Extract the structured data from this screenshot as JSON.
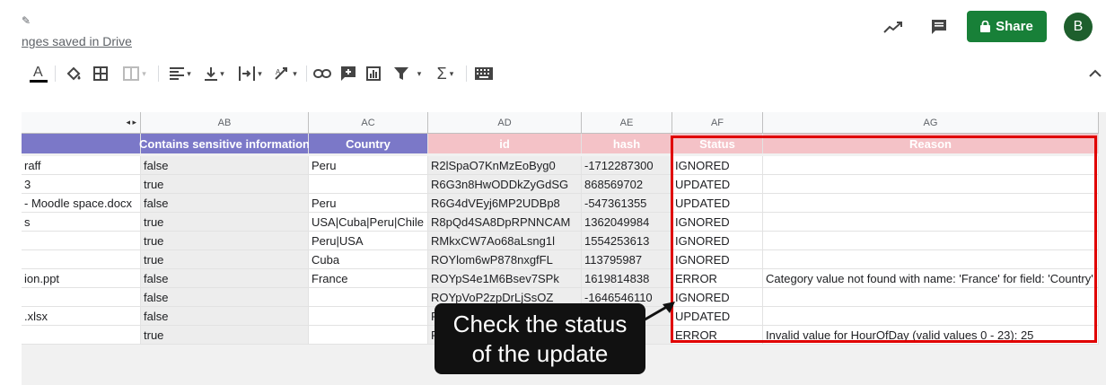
{
  "header": {
    "save_status": "nges saved in Drive",
    "share_label": "Share",
    "avatar_initial": "B",
    "icons": [
      "pencil-icon",
      "activity-trend-icon",
      "comment-icon",
      "lock-icon"
    ]
  },
  "toolbar": {
    "icons": [
      "text-color-icon",
      "fill-color-icon",
      "borders-icon",
      "merge-cells-icon",
      "align-horizontal-icon",
      "align-vertical-icon",
      "text-wrap-icon",
      "text-rotate-icon",
      "link-icon",
      "insert-comment-icon",
      "insert-chart-icon",
      "filter-icon",
      "functions-icon",
      "keyboard-icon",
      "collapse-icon"
    ]
  },
  "columns": [
    "AB",
    "AC",
    "AD",
    "AE",
    "AF",
    "AG"
  ],
  "header_row": {
    "col0": "",
    "AB": "Contains sensitive information",
    "AC": "Country",
    "AD": "id",
    "AE": "hash",
    "AF": "Status",
    "AG": "Reason"
  },
  "rows": [
    {
      "c0": "raff",
      "AB": "false",
      "AC": "Peru",
      "AD": "R2lSpaO7KnMzEoByg0",
      "AE": "-1712287300",
      "AF": "IGNORED",
      "AG": ""
    },
    {
      "c0": "3",
      "AB": "true",
      "AC": "",
      "AD": "R6G3n8HwODDkZyGdSG",
      "AE": "868569702",
      "AF": "UPDATED",
      "AG": ""
    },
    {
      "c0": "- Moodle space.docx",
      "AB": "false",
      "AC": "Peru",
      "AD": "R6G4dVEyj6MP2UDBp8",
      "AE": "-547361355",
      "AF": "UPDATED",
      "AG": ""
    },
    {
      "c0": "s",
      "AB": "true",
      "AC": "USA|Cuba|Peru|Chile",
      "AD": "R8pQd4SA8DpRPNNCAM",
      "AE": "1362049984",
      "AF": "IGNORED",
      "AG": ""
    },
    {
      "c0": "",
      "AB": "true",
      "AC": "Peru|USA",
      "AD": "RMkxCW7Ao68aLsng1l",
      "AE": "1554253613",
      "AF": "IGNORED",
      "AG": ""
    },
    {
      "c0": "",
      "AB": "true",
      "AC": "Cuba",
      "AD": "ROYlom6wP878nxgfFL",
      "AE": "113795987",
      "AF": "IGNORED",
      "AG": ""
    },
    {
      "c0": "ion.ppt",
      "AB": "false",
      "AC": "France",
      "AD": "ROYpS4e1M6Bsev7SPk",
      "AE": "1619814838",
      "AF": "ERROR",
      "AG": "Category value not found with name: 'France' for field: 'Country'"
    },
    {
      "c0": "",
      "AB": "false",
      "AC": "",
      "AD": "ROYpVoP2zpDrLjSsOZ",
      "AE": "-1646546110",
      "AF": "IGNORED",
      "AG": ""
    },
    {
      "c0": ".xlsx",
      "AB": "false",
      "AC": "",
      "AD": "R",
      "AE": "",
      "AF": "UPDATED",
      "AG": ""
    },
    {
      "c0": "",
      "AB": "true",
      "AC": "",
      "AD": "R",
      "AE": "",
      "AF": "ERROR",
      "AG": "Invalid value for HourOfDay (valid values 0 - 23): 25"
    }
  ],
  "callout": {
    "line1": "Check the status",
    "line2": "of the update"
  },
  "colors": {
    "header_purple": "#7b78c8",
    "header_pink": "#f4c2c7",
    "highlight_red": "#e00000",
    "share_green": "#188038"
  }
}
